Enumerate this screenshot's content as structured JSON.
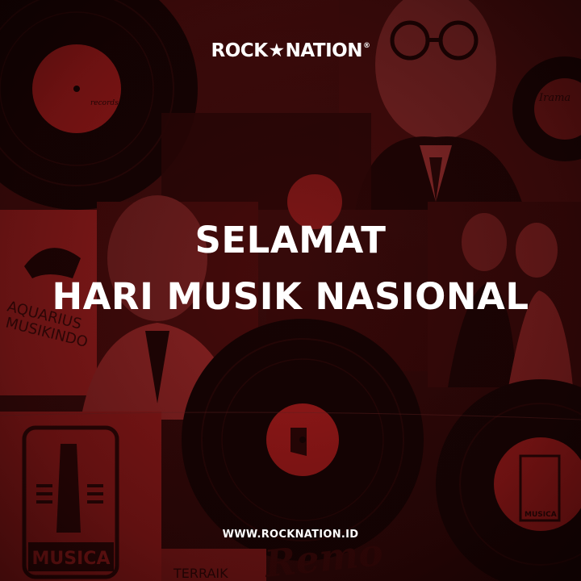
{
  "brand": {
    "logo_left": "ROCK",
    "logo_star": "★",
    "logo_right": "NATION",
    "logo_mark": "®"
  },
  "headline": {
    "line1": "SELAMAT",
    "line2": "HARI MUSIK NASIONAL"
  },
  "footer": {
    "website": "WWW.ROCKNATION.ID"
  },
  "background": {
    "label_records": "records",
    "label_aquarius_1": "AQUARIUS",
    "label_aquarius_2": "MUSIKINDO",
    "label_musica_1": "MUSICA",
    "label_musica_2": "MUSICA",
    "label_terbaik": "TERRAIK",
    "label_remo": "Remo",
    "label_irama": "Irama"
  },
  "colors": {
    "dark_red": "#2a0606",
    "mid_red": "#5a1010",
    "bright_red": "#b41e1e",
    "vinyl": "#120303",
    "text": "#ffffff"
  }
}
